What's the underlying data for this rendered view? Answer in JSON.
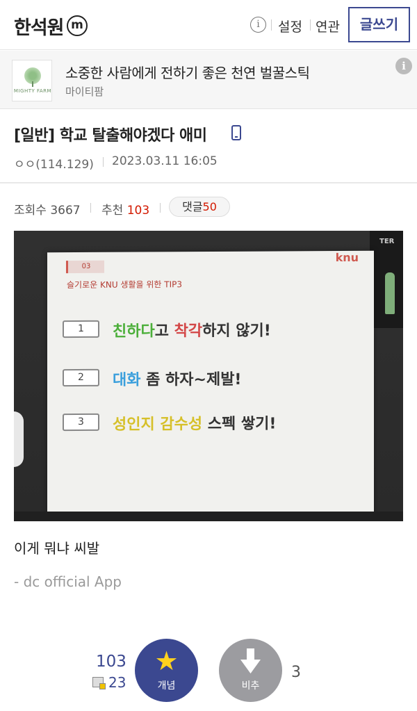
{
  "header": {
    "gallery_name": "한석원",
    "minor_badge": "m",
    "info_symbol": "i",
    "settings_label": "설정",
    "related_label": "연관",
    "write_label": "글쓰기"
  },
  "ad": {
    "title": "소중한 사람에게 전하기 좋은 천연 벌꿀스틱",
    "advertiser": "마이티팜",
    "logo_text": "MIGHTY FARM",
    "info_symbol": "i"
  },
  "post": {
    "title": "[일반] 학교 탈출해야겠다 애미",
    "author": "ㅇㅇ(114.129)",
    "datetime": "2023.03.11 16:05",
    "views_label": "조회수",
    "views": "3667",
    "recommend_label": "추천",
    "recommend": "103",
    "comments_label": "댓글",
    "comments": "50",
    "body": "이게 뭐냐 씨발",
    "signature": "- dc official App"
  },
  "photo": {
    "slide_number": "03",
    "slide_logo": "knu",
    "slide_subtitle": "슬기로운 KNU 생활을 위한 TIP3",
    "rows": [
      {
        "num": "1",
        "a": "친하다",
        "b": "고 ",
        "c": "착각",
        "d": "하지 않기!"
      },
      {
        "num": "2",
        "a": "대화",
        "b": " 좀 하자~제발!",
        "c": "",
        "d": ""
      },
      {
        "num": "3",
        "a": "성인지 감수성",
        "b": " 스펙 쌓기!",
        "c": "",
        "d": ""
      }
    ],
    "side_label": "TER"
  },
  "vote": {
    "recommend_count": "103",
    "fix_count": "23",
    "up_label": "개념",
    "down_label": "비추",
    "down_count": "3"
  },
  "colors": {
    "brand": "#3b4890",
    "accent_red": "#d31900",
    "downvote": "#9c9ca0"
  },
  "icons": [
    "info-icon",
    "phone-icon",
    "star-icon",
    "arrow-down-icon",
    "fix-icon"
  ]
}
